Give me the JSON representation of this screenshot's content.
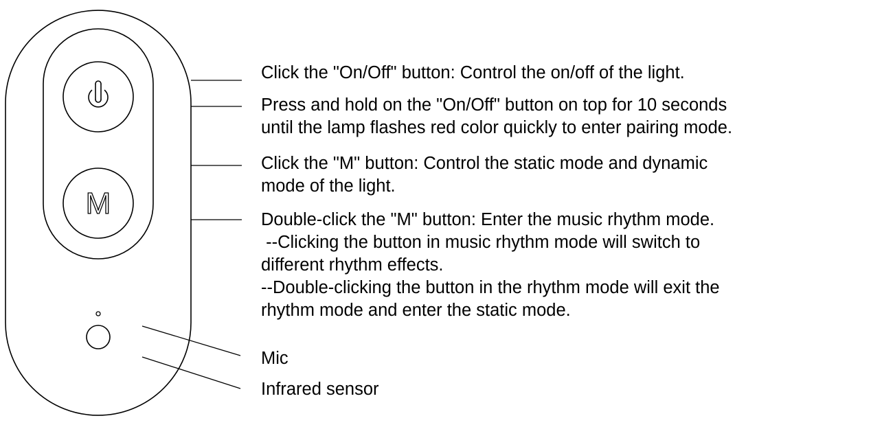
{
  "remote": {
    "power_icon": "power-icon",
    "m_button_label": "M"
  },
  "callouts": {
    "onoff_click": "Click the \"On/Off\" button: Control the on/off of the light.",
    "onoff_hold": "Press and hold on the \"On/Off\" button on top for 10 seconds\nuntil the lamp flashes red color quickly to enter pairing mode.",
    "m_click": "Click the \"M\" button: Control the static mode and dynamic\nmode of the light.",
    "m_double": "Double-click the \"M\" button: Enter the music rhythm mode.\n --Clicking the button in music rhythm mode will switch to\ndifferent rhythm effects.\n--Double-clicking the button in the rhythm mode will exit the\nrhythm mode and enter the static mode.",
    "mic": "Mic",
    "infrared": "Infrared sensor"
  }
}
